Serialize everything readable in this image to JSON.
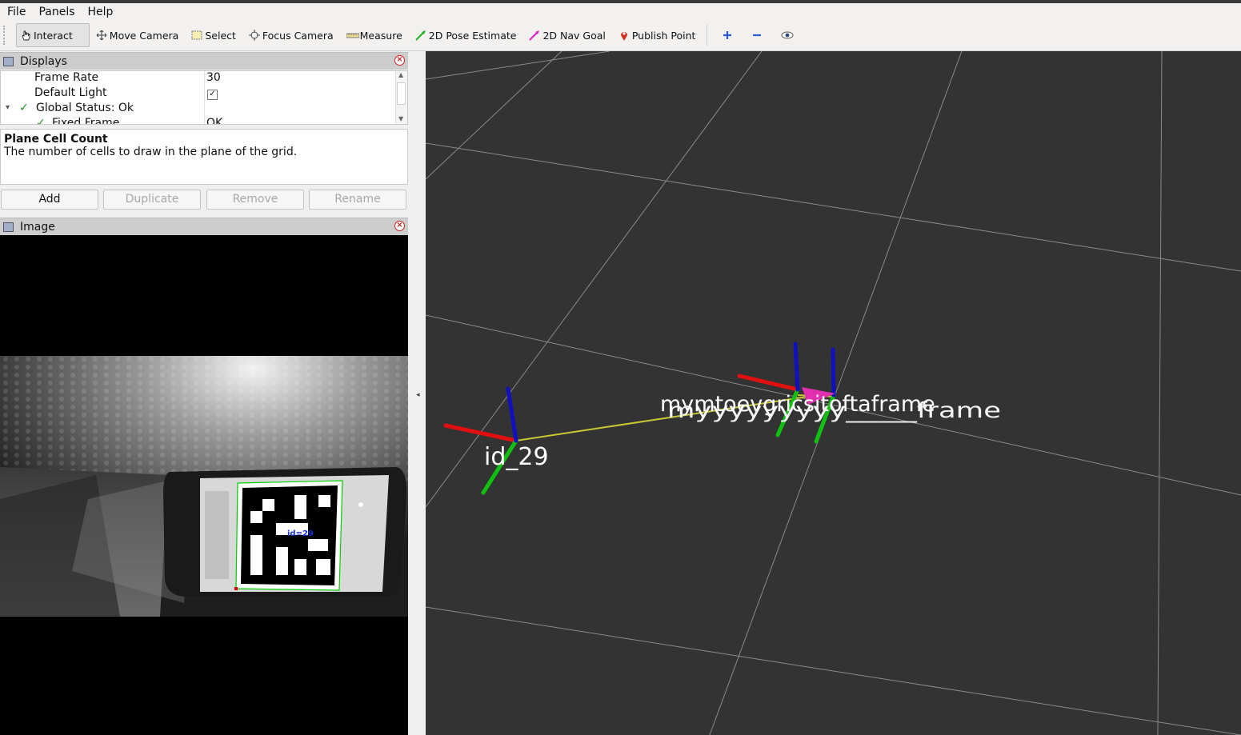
{
  "menu": {
    "file": "File",
    "panels": "Panels",
    "help": "Help"
  },
  "toolbar": {
    "interact": "Interact",
    "move_camera": "Move Camera",
    "select": "Select",
    "focus_camera": "Focus Camera",
    "measure": "Measure",
    "pose_estimate": "2D Pose Estimate",
    "nav_goal": "2D Nav Goal",
    "publish_point": "Publish Point"
  },
  "displays": {
    "title": "Displays",
    "rows": [
      {
        "name": "Frame Rate",
        "value": "30"
      },
      {
        "name": "Default Light",
        "value": "✓"
      },
      {
        "name": "Global Status: Ok",
        "value": ""
      },
      {
        "name": "Fixed Frame",
        "value": "OK"
      }
    ],
    "description_title": "Plane Cell Count",
    "description_text": "The number of cells to draw in the plane of the grid.",
    "buttons": {
      "add": "Add",
      "duplicate": "Duplicate",
      "remove": "Remove",
      "rename": "Rename"
    }
  },
  "image_panel": {
    "title": "Image",
    "marker_label": "id=29"
  },
  "viewport": {
    "frame_labels": {
      "marker": "id_29",
      "overlap_a": "mymtoevgricsitoftaframe",
      "overlap_b": "myyyyyyyyy_____frame"
    },
    "colors": {
      "background": "#333333",
      "grid": "#8a8a8a",
      "x_axis": "#e01010",
      "y_axis": "#10c010",
      "z_axis": "#1010c0",
      "link": "#c8c832",
      "pose_arrow": "#e030b0"
    }
  }
}
